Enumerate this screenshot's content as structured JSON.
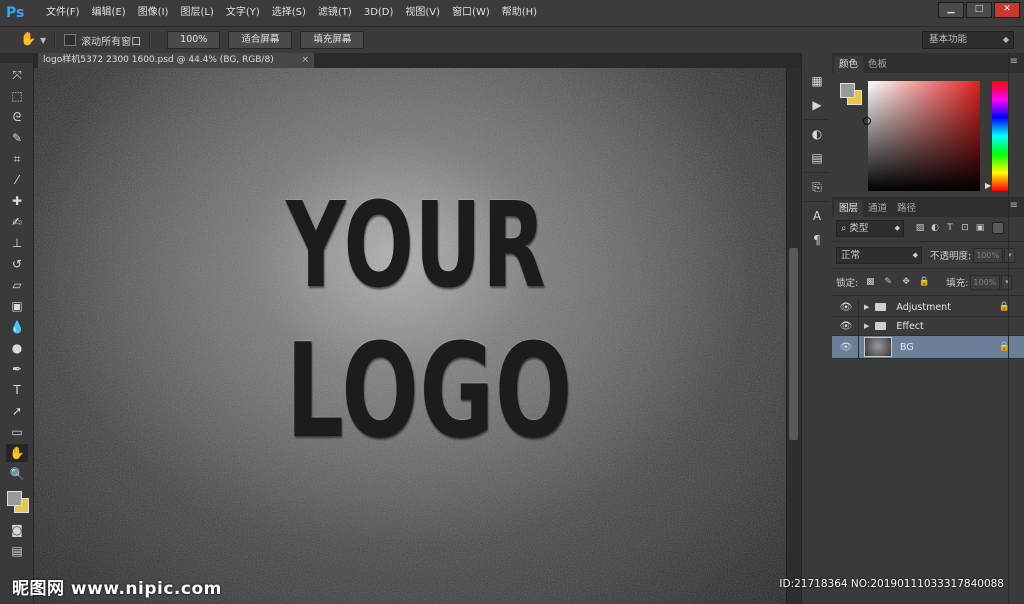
{
  "app": {
    "logo": "Ps",
    "menu": [
      "文件(F)",
      "编辑(E)",
      "图像(I)",
      "图层(L)",
      "文字(Y)",
      "选择(S)",
      "滤镜(T)",
      "3D(D)",
      "视图(V)",
      "窗口(W)",
      "帮助(H)"
    ],
    "window_controls": {
      "minimize": "▁",
      "maximize": "□",
      "close": "✕"
    }
  },
  "options_bar": {
    "scroll_all_label": "滚动所有窗口",
    "zoom_100": "100%",
    "fit_screen": "适合屏幕",
    "fill_screen": "填充屏幕",
    "workspace": "基本功能"
  },
  "document": {
    "tab_title": "logo样机5372 2300 1600.psd @ 44.4% (BG, RGB/8)",
    "close": "×",
    "canvas_text_line1": "YOUR",
    "canvas_text_line2": "LOGO"
  },
  "tools": [
    "move-tool",
    "marquee-tool",
    "lasso-tool",
    "quick-select-tool",
    "crop-tool",
    "eyedropper-tool",
    "spot-heal-tool",
    "brush-tool",
    "stamp-tool",
    "history-brush-tool",
    "eraser-tool",
    "gradient-tool",
    "blur-tool",
    "dodge-tool",
    "pen-tool",
    "type-tool",
    "path-select-tool",
    "rectangle-tool",
    "hand-tool",
    "zoom-tool"
  ],
  "colors": {
    "foreground": "#9a9a9a",
    "background": "#e7c846",
    "accent": "#31a8ff",
    "selected_layer": "#6b7f99"
  },
  "color_panel": {
    "tabs": [
      "颜色",
      "色板"
    ],
    "active_tab": "颜色"
  },
  "layers_panel": {
    "tabs": [
      "图层",
      "通道",
      "路径"
    ],
    "active_tab": "图层",
    "filter": "类型",
    "blend_mode": "正常",
    "opacity_label": "不透明度:",
    "opacity_value": "100%",
    "lock_label": "锁定:",
    "fill_label": "填充:",
    "fill_value": "100%",
    "layers": [
      {
        "name": "Adjustment",
        "type": "group",
        "visible": true,
        "locked": true,
        "selected": false
      },
      {
        "name": "Effect",
        "type": "group",
        "visible": true,
        "locked": false,
        "selected": false
      },
      {
        "name": "BG",
        "type": "layer",
        "visible": true,
        "locked": true,
        "selected": true
      }
    ]
  },
  "watermark": {
    "left": "昵图网 www.nipic.com",
    "right": "ID:21718364 NO:20190111033317840088"
  }
}
